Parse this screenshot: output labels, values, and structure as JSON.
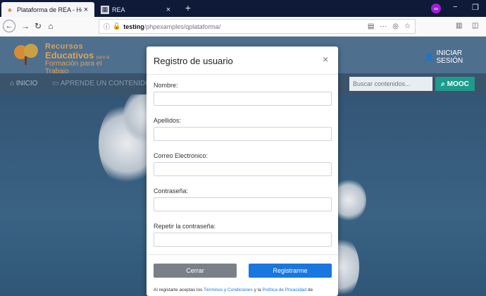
{
  "browser": {
    "tabs": [
      {
        "title": "Plataforma de REA - Home",
        "active": true
      },
      {
        "title": "REA",
        "active": false
      }
    ],
    "new_tab_label": "+",
    "url": {
      "host": "testing",
      "path": "/phpexamples/qplataforma/"
    },
    "private_badge": "∞"
  },
  "site": {
    "logo": {
      "line1": "Recursos",
      "line2": "Educativos",
      "line2_suffix": "para la",
      "line3": "Formación para el Trabajo"
    },
    "login_label": "INICIAR SESIÓN",
    "nav": {
      "home": "INICIO",
      "learn": "APRENDE UN CONTENIDO"
    },
    "search": {
      "placeholder": "Buscar contenidos..."
    },
    "mooc_label": "MOOC"
  },
  "modal": {
    "title": "Registro de usuario",
    "close": "×",
    "fields": [
      {
        "label": "Nombre:",
        "value": ""
      },
      {
        "label": "Apellidos:",
        "value": ""
      },
      {
        "label": "Correo Electronico:",
        "value": ""
      },
      {
        "label": "Contraseña:",
        "value": ""
      },
      {
        "label": "Repetir la contraseña:",
        "value": ""
      }
    ],
    "cancel_label": "Cerrar",
    "submit_label": "Registrarme",
    "terms": {
      "prefix": "Al registarte aceptas los ",
      "terms_link": "Términos y Condiciones",
      "middle": " y la ",
      "privacy_link": "Política de Privacidad",
      "suffix": " de"
    }
  },
  "colors": {
    "accent": "#1977e0",
    "mooc": "#1d9b8d",
    "header": "#4e6f8e",
    "cancel": "#7a8088"
  }
}
